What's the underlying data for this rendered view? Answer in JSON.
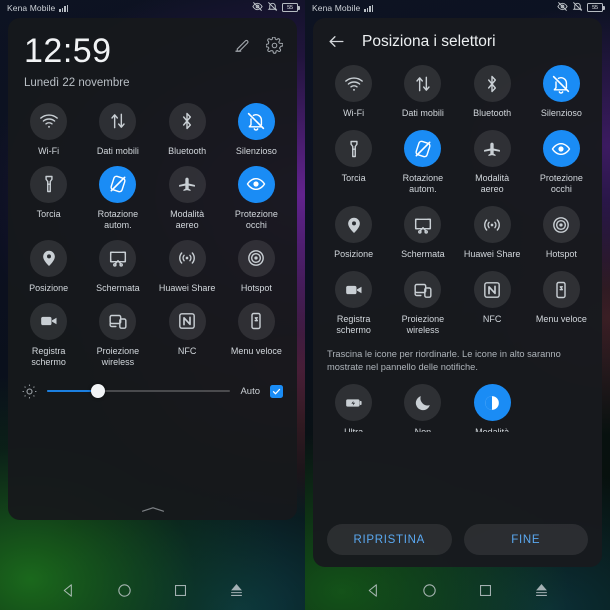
{
  "status_bar": {
    "carrier": "Kena Mobile",
    "signal_icon": "signal-bars-icon",
    "eye_icon": "eye-off-icon",
    "alarm_icon": "alarm-off-icon",
    "battery_level": "55"
  },
  "left_panel": {
    "clock": "12:59",
    "date": "Lunedì 22 novembre",
    "edit_icon": "pencil-icon",
    "settings_icon": "gear-icon",
    "tiles": [
      {
        "label": "Wi-Fi",
        "icon": "wifi-icon",
        "active": false
      },
      {
        "label": "Dati mobili",
        "icon": "data-transfer-icon",
        "active": false
      },
      {
        "label": "Bluetooth",
        "icon": "bluetooth-icon",
        "active": false
      },
      {
        "label": "Silenzioso",
        "icon": "bell-off-icon",
        "active": true
      },
      {
        "label": "Torcia",
        "icon": "flashlight-icon",
        "active": false
      },
      {
        "label": "Rotazione\nautom.",
        "icon": "rotation-lock-icon",
        "active": true
      },
      {
        "label": "Modalità\naereo",
        "icon": "airplane-icon",
        "active": false
      },
      {
        "label": "Protezione\nocchi",
        "icon": "eye-icon",
        "active": true
      },
      {
        "label": "Posizione",
        "icon": "location-pin-icon",
        "active": false
      },
      {
        "label": "Schermata",
        "icon": "screenshot-icon",
        "active": false
      },
      {
        "label": "Huawei Share",
        "icon": "share-waves-icon",
        "active": false
      },
      {
        "label": "Hotspot",
        "icon": "hotspot-icon",
        "active": false
      },
      {
        "label": "Registra\nschermo",
        "icon": "video-camera-icon",
        "active": false
      },
      {
        "label": "Proiezione\nwireless",
        "icon": "cast-screen-icon",
        "active": false
      },
      {
        "label": "NFC",
        "icon": "nfc-icon",
        "active": false
      },
      {
        "label": "Menu veloce",
        "icon": "quick-menu-icon",
        "active": false
      }
    ],
    "brightness": {
      "icon": "brightness-sun-icon",
      "value_percent": 28,
      "auto_label": "Auto",
      "auto_checked": true
    },
    "handle_icon": "chevron-up-handle-icon"
  },
  "right_panel": {
    "back_icon": "back-arrow-icon",
    "title": "Posiziona i selettori",
    "tiles": [
      {
        "label": "Wi-Fi",
        "icon": "wifi-icon",
        "active": false
      },
      {
        "label": "Dati mobili",
        "icon": "data-transfer-icon",
        "active": false
      },
      {
        "label": "Bluetooth",
        "icon": "bluetooth-icon",
        "active": false
      },
      {
        "label": "Silenzioso",
        "icon": "bell-off-icon",
        "active": true
      },
      {
        "label": "Torcia",
        "icon": "flashlight-icon",
        "active": false
      },
      {
        "label": "Rotazione\nautom.",
        "icon": "rotation-lock-icon",
        "active": true
      },
      {
        "label": "Modalità\naereo",
        "icon": "airplane-icon",
        "active": false
      },
      {
        "label": "Protezione\nocchi",
        "icon": "eye-icon",
        "active": true
      },
      {
        "label": "Posizione",
        "icon": "location-pin-icon",
        "active": false
      },
      {
        "label": "Schermata",
        "icon": "screenshot-icon",
        "active": false
      },
      {
        "label": "Huawei Share",
        "icon": "share-waves-icon",
        "active": false
      },
      {
        "label": "Hotspot",
        "icon": "hotspot-icon",
        "active": false
      },
      {
        "label": "Registra\nschermo",
        "icon": "video-camera-icon",
        "active": false
      },
      {
        "label": "Proiezione\nwireless",
        "icon": "cast-screen-icon",
        "active": false
      },
      {
        "label": "NFC",
        "icon": "nfc-icon",
        "active": false
      },
      {
        "label": "Menu veloce",
        "icon": "quick-menu-icon",
        "active": false
      }
    ],
    "hint": "Trascina le icone per riordinarle. Le icone in alto saranno mostrate nel pannello delle notifiche.",
    "tiles_bottom": [
      {
        "label": "Ultra\nrisparmio",
        "icon": "battery-saver-icon",
        "active": false
      },
      {
        "label": "Non\ndisturbare",
        "icon": "moon-icon",
        "active": false
      },
      {
        "label": "Modalità\nscura",
        "icon": "dark-mode-icon",
        "active": true
      }
    ],
    "reset_label": "RIPRISTINA",
    "done_label": "FINE"
  },
  "nav_bar": {
    "back": "back-triangle-icon",
    "home": "home-circle-icon",
    "recents": "recents-square-icon",
    "hide": "hide-navbar-icon"
  },
  "colors": {
    "accent_blue": "#1a8cf5",
    "panel_bg": "#16181c",
    "text_primary": "#edf0f2",
    "text_secondary": "#aeb4ba"
  }
}
